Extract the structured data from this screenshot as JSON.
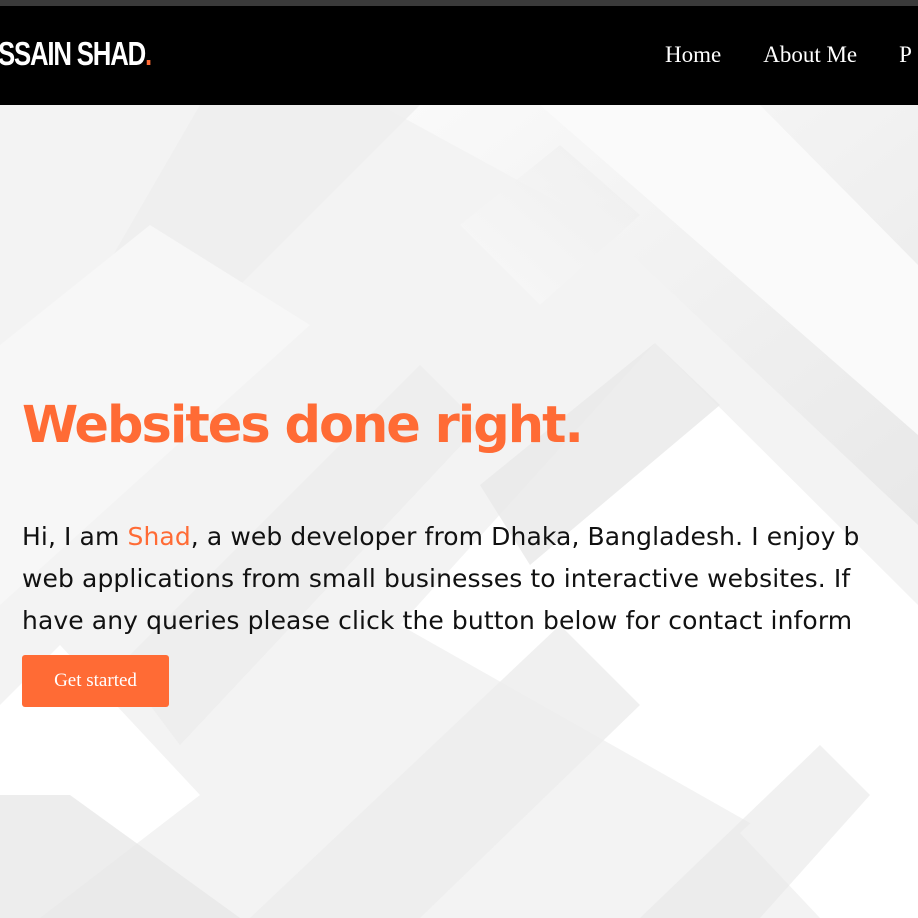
{
  "header": {
    "logo_text": "SSAIN SHAD",
    "logo_dot": ".",
    "nav": [
      {
        "label": "Home"
      },
      {
        "label": "About Me"
      },
      {
        "label": "P"
      }
    ]
  },
  "hero": {
    "title": "Websites done right.",
    "intro_prefix": "Hi, I am ",
    "name": "Shad",
    "intro_line1_rest": ", a web developer from Dhaka, Bangladesh. I enjoy b",
    "intro_line2": "web applications from small businesses to interactive websites. If",
    "intro_line3": "have any queries please click the button below for contact inform",
    "cta_label": "Get started"
  },
  "colors": {
    "accent": "#ff6b35",
    "navbar_bg": "#000000",
    "hero_bg": "#f3f3f3"
  }
}
